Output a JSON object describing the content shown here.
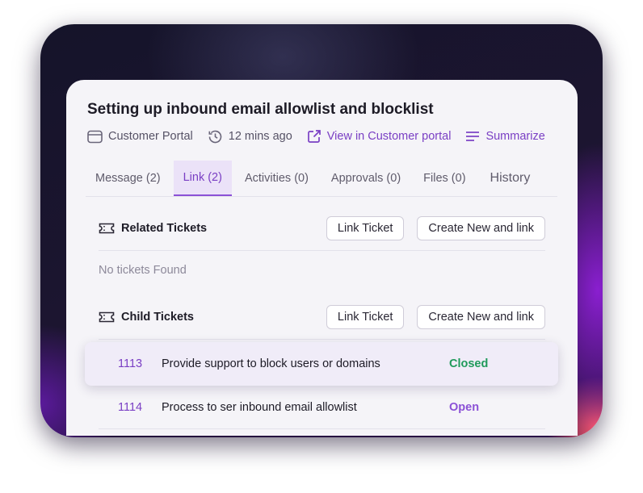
{
  "ticket": {
    "title": "Setting up inbound email allowlist and blocklist",
    "meta": {
      "source": "Customer Portal",
      "time": "12 mins ago",
      "view_link": "View in Customer portal",
      "summarize": "Summarize"
    }
  },
  "tabs": [
    {
      "label": "Message (2)"
    },
    {
      "label": "Link (2)",
      "active": true
    },
    {
      "label": "Activities (0)"
    },
    {
      "label": "Approvals (0)"
    },
    {
      "label": "Files (0)"
    },
    {
      "label": "History"
    }
  ],
  "related": {
    "title": "Related Tickets",
    "link_button": "Link Ticket",
    "create_button": "Create New and link",
    "empty_text": "No tickets Found"
  },
  "child": {
    "title": "Child Tickets",
    "link_button": "Link Ticket",
    "create_button": "Create New and link",
    "rows": [
      {
        "id": "1113",
        "subject": "Provide support to block users or domains",
        "status": "Closed",
        "status_color": "#1f9a5a"
      },
      {
        "id": "1114",
        "subject": "Process to ser inbound email allowlist",
        "status": "Open",
        "status_color": "#8b51d6"
      }
    ]
  },
  "colors": {
    "accent": "#7a3fc4",
    "closed": "#1f9a5a",
    "open": "#8b51d6"
  }
}
